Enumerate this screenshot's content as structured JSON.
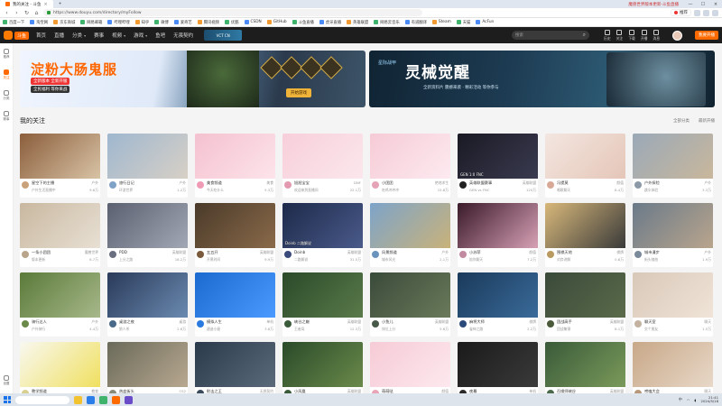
{
  "browser": {
    "tab_active": "我的关注 - 斗鱼",
    "tab_right": "魔兽世界版本更新-斗鱼直播",
    "url": "https://www.douyu.com/directory/myFollow",
    "promo": "推荐",
    "bookmarks": [
      "百度一下",
      "淘宝网",
      "京东商城",
      "网易邮箱",
      "哔哩哔哩",
      "知乎",
      "微博",
      "爱奇艺",
      "腾讯视频",
      "优酷",
      "CSDN",
      "GitHub",
      "斗鱼直播",
      "虎牙直播",
      "英雄联盟",
      "网易云音乐",
      "有道翻译",
      "Steam",
      "天猫",
      "AcFun"
    ]
  },
  "site": {
    "logo": "斗鱼",
    "nav": [
      {
        "label": "首页",
        "chev": false
      },
      {
        "label": "直播",
        "chev": false
      },
      {
        "label": "分类",
        "chev": true
      },
      {
        "label": "赛事",
        "chev": false
      },
      {
        "label": "视频",
        "chev": true
      },
      {
        "label": "游戏",
        "chev": true
      },
      {
        "label": "鱼吧",
        "chev": false
      },
      {
        "label": "无畏契约",
        "chev": false
      }
    ],
    "live_promo": "VCT CN",
    "search_placeholder": "搜索",
    "header_icons": [
      "历史",
      "关注",
      "下载",
      "开播",
      "消息"
    ],
    "open_live": "我要开播"
  },
  "sidebar": {
    "items": [
      "推荐",
      "关注",
      "分类",
      "赛事"
    ],
    "bottom": "设置"
  },
  "banners": {
    "left": {
      "title": "淀粉大肠鬼服",
      "sub": "全新版本 全新开服",
      "sub2": "全民福利 等你来战",
      "button": "开始游戏"
    },
    "right": {
      "logo": "星际战甲",
      "title": "灵械觉醒",
      "sub": "全新资料片 震撼来袭 · 精彩活动 等你参与"
    }
  },
  "follow": {
    "title": "我的关注",
    "opts": [
      "全部分类",
      "最新开播"
    ]
  },
  "cards": [
    {
      "name": "星空下的主播",
      "cat": "户外",
      "viewers": "9.6万",
      "sub": "户外生活直播中",
      "time": "3小时",
      "c1": "#8b5e3c",
      "c2": "#d8c3a5",
      "av": "#c9a27c",
      "label": ""
    },
    {
      "name": "旅行日记",
      "cat": "户外",
      "viewers": "1.2万",
      "sub": "环游世界",
      "time": "1小时",
      "c1": "#9fb7cf",
      "c2": "#d7d0c6",
      "av": "#7fa3c7",
      "label": ""
    },
    {
      "name": "美食频道",
      "cat": "美食",
      "viewers": "5.3万",
      "sub": "今天吃什么",
      "time": "2小时",
      "c1": "#f4c1cf",
      "c2": "#fde4ea",
      "av": "#f09bb5",
      "label": ""
    },
    {
      "name": "旭旭宝宝",
      "cat": "DNF",
      "viewers": "22.1万",
      "sub": "欢迎来到直播间",
      "time": "5小时",
      "c1": "#f8cfda",
      "c2": "#fbe7ec",
      "av": "#e39ab0",
      "label": ""
    },
    {
      "name": "小团团",
      "cat": "绝地求生",
      "viewers": "15.8万",
      "sub": "吃鸡冲冲冲",
      "time": "4小时",
      "c1": "#f6cbd6",
      "c2": "#fdeaf0",
      "av": "#e6a2b6",
      "label": ""
    },
    {
      "name": "英雄联盟赛事",
      "cat": "英雄联盟",
      "viewers": "120万",
      "sub": "GEN vs FNC",
      "time": "1小时",
      "c1": "#1a1a24",
      "c2": "#3a3a50",
      "av": "#222",
      "label": "GEN 1:0 FNC"
    },
    {
      "name": "冯提莫",
      "cat": "颜值",
      "viewers": "8.4万",
      "sub": "唱歌聊天",
      "time": "2小时",
      "c1": "#f3e6e0",
      "c2": "#e5c6b8",
      "av": "#d8a996",
      "label": ""
    },
    {
      "name": "户外探险",
      "cat": "户外",
      "viewers": "3.3万",
      "sub": "跳伞体验",
      "time": "1小时",
      "c1": "#9aa9b8",
      "c2": "#c9b79c",
      "av": "#8c9aa8",
      "label": ""
    },
    {
      "name": "一条小团团",
      "cat": "魔兽世界",
      "viewers": "6.7万",
      "sub": "版本更新",
      "time": "3小时",
      "c1": "#c9b8a0",
      "c2": "#e8e0d4",
      "av": "#b9a58c",
      "label": ""
    },
    {
      "name": "PDD",
      "cat": "英雄联盟",
      "viewers": "18.2万",
      "sub": "上分之路",
      "time": "6小时",
      "c1": "#5a6070",
      "c2": "#a3a8b5",
      "av": "#6a6f80",
      "label": ""
    },
    {
      "name": "五五开",
      "cat": "英雄联盟",
      "viewers": "9.9万",
      "sub": "开黑时间",
      "time": "2小时",
      "c1": "#4a3a2a",
      "c2": "#8a6a4a",
      "av": "#7a5a3a",
      "label": ""
    },
    {
      "name": "Doinb",
      "cat": "英雄联盟",
      "viewers": "31.5万",
      "sub": "二路解说",
      "time": "4小时",
      "c1": "#1d2a4a",
      "c2": "#4a5a8a",
      "av": "#3a4a7a",
      "label": "Doinb 二路解说"
    },
    {
      "name": "风景频道",
      "cat": "户外",
      "viewers": "2.1万",
      "sub": "城市风光",
      "time": "1小时",
      "c1": "#7da4c9",
      "c2": "#c9b27a",
      "av": "#6a94bd",
      "label": ""
    },
    {
      "name": "小苏菲",
      "cat": "颜值",
      "viewers": "7.2万",
      "sub": "陪你聊天",
      "time": "3小时",
      "c1": "#3a1a2a",
      "c2": "#d7a0b5",
      "av": "#c28aa0",
      "label": ""
    },
    {
      "name": "围棋天地",
      "cat": "棋牌",
      "viewers": "0.8万",
      "sub": "对弈讲解",
      "time": "2小时",
      "c1": "#d8b87a",
      "c2": "#3a3a3a",
      "av": "#b99a60",
      "label": ""
    },
    {
      "name": "城市漫步",
      "cat": "户外",
      "viewers": "1.9万",
      "sub": "街头随拍",
      "time": "1小时",
      "c1": "#6a7a8a",
      "c2": "#b9a58c",
      "av": "#7a8a9a",
      "label": ""
    },
    {
      "name": "骑行达人",
      "cat": "户外",
      "viewers": "4.4万",
      "sub": "户外骑行",
      "time": "2小时",
      "c1": "#5b7a3a",
      "c2": "#a7b88a",
      "av": "#6b8a4a",
      "label": ""
    },
    {
      "name": "桌游之夜",
      "cat": "桌游",
      "viewers": "2.6万",
      "sub": "狼人杀",
      "time": "3小时",
      "c1": "#2a3a5a",
      "c2": "#6a8ab0",
      "av": "#4a6a8a",
      "label": ""
    },
    {
      "name": "模拟人生",
      "cat": "单机",
      "viewers": "3.8万",
      "sub": "建造小屋",
      "time": "2小时",
      "c1": "#1a6ad0",
      "c2": "#4a9aff",
      "av": "#2a7ae0",
      "label": ""
    },
    {
      "name": "峡谷之巅",
      "cat": "英雄联盟",
      "viewers": "12.3万",
      "sub": "王者局",
      "time": "5小时",
      "c1": "#2a4a2a",
      "c2": "#5a7a4a",
      "av": "#3a5a3a",
      "label": ""
    },
    {
      "name": "小鱼儿",
      "cat": "英雄联盟",
      "viewers": "5.6万",
      "sub": "排位上分",
      "time": "2小时",
      "c1": "#3a4a3a",
      "c2": "#6a7a5a",
      "av": "#4a5a4a",
      "label": ""
    },
    {
      "name": "麻将大师",
      "cat": "棋牌",
      "viewers": "2.2万",
      "sub": "雀神之路",
      "time": "4小时",
      "c1": "#1a3a5a",
      "c2": "#3a6a9a",
      "av": "#2a4a7a",
      "label": ""
    },
    {
      "name": "团战高手",
      "cat": "英雄联盟",
      "viewers": "8.1万",
      "sub": "团战集锦",
      "time": "3小时",
      "c1": "#3a4a3a",
      "c2": "#5a6a4a",
      "av": "#4a5a3a",
      "label": ""
    },
    {
      "name": "聊天室",
      "cat": "聊天",
      "viewers": "1.5万",
      "sub": "交个朋友",
      "time": "1小时",
      "c1": "#d8c8b8",
      "c2": "#f0e4d8",
      "av": "#c4b2a0",
      "label": ""
    },
    {
      "name": "教学频道",
      "cat": "教育",
      "viewers": "0.6万",
      "sub": "知识分享",
      "time": "2小时",
      "c1": "#f8f8f0",
      "c2": "#f0e060",
      "av": "#d8d090",
      "label": ""
    },
    {
      "name": "热血街头",
      "cat": "CS2",
      "viewers": "4.9万",
      "sub": "竞技模式",
      "time": "2小时",
      "c1": "#6a6a5a",
      "c2": "#b8a890",
      "av": "#8a8a7a",
      "label": ""
    },
    {
      "name": "射击之王",
      "cat": "无畏契约",
      "viewers": "6.3万",
      "sub": "排位冲分",
      "time": "3小时",
      "c1": "#2a3a4a",
      "c2": "#5a6a7a",
      "av": "#3a4a5a",
      "label": ""
    },
    {
      "name": "小凤凰",
      "cat": "英雄联盟",
      "viewers": "3.1万",
      "sub": "双排",
      "time": "1小时",
      "c1": "#2a4a2a",
      "c2": "#6a8a4a",
      "av": "#3a5a3a",
      "label": ""
    },
    {
      "name": "萌萌哒",
      "cat": "颜值",
      "viewers": "9.2万",
      "sub": "唱跳rap",
      "time": "4小时",
      "c1": "#f6cbd6",
      "c2": "#fde8ee",
      "av": "#e8a5b8",
      "label": ""
    },
    {
      "name": "夜幕",
      "cat": "单机",
      "viewers": "1.4万",
      "sub": "恐怖游戏",
      "time": "2小时",
      "c1": "#1a1a1a",
      "c2": "#3a3a3a",
      "av": "#2a2a2a",
      "label": ""
    },
    {
      "name": "召唤师峡谷",
      "cat": "英雄联盟",
      "viewers": "7.7万",
      "sub": "一起开黑",
      "time": "3小时",
      "c1": "#3a5a3a",
      "c2": "#7a9a5a",
      "av": "#4a6a4a",
      "label": ""
    },
    {
      "name": "唠嗑大会",
      "cat": "聊天",
      "viewers": "2.8万",
      "sub": "深夜电台",
      "time": "2小时",
      "c1": "#c8a888",
      "c2": "#e8d8c8",
      "av": "#b89878",
      "label": ""
    }
  ],
  "taskbar": {
    "time": "21:41",
    "date": "2024/5/18",
    "tray": "中"
  },
  "colors": {
    "accent": "#ff6a00",
    "header_bg": "#1d1d1d"
  }
}
